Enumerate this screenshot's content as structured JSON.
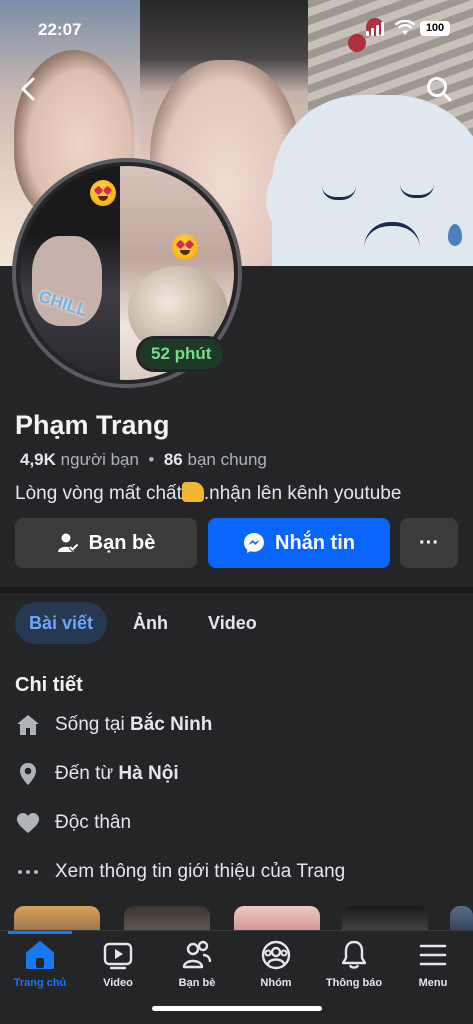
{
  "status_bar": {
    "time": "22:07",
    "battery": "100"
  },
  "profile": {
    "avatar_badge": "52 phút",
    "avatar_sticker": "CHILL",
    "name": "Phạm Trang",
    "friends_count": "4,9K",
    "friends_label": "người bạn",
    "mutual_count": "86",
    "mutual_label": "bạn chung",
    "bio_before": "Lòng vòng mất chất",
    "bio_after": ".nhận lên kênh youtube"
  },
  "actions": {
    "friends": "Bạn bè",
    "message": "Nhắn tin",
    "more": "···"
  },
  "tabs": [
    {
      "label": "Bài viết",
      "active": true
    },
    {
      "label": "Ảnh",
      "active": false
    },
    {
      "label": "Video",
      "active": false
    }
  ],
  "details": {
    "title": "Chi tiết",
    "lives_prefix": "Sống tại ",
    "lives_place": "Bắc Ninh",
    "from_prefix": "Đến từ ",
    "from_place": "Hà Nội",
    "relationship": "Độc thân",
    "see_more": "Xem thông tin giới thiệu của Trang"
  },
  "bottom_nav": [
    {
      "label": "Trang chủ",
      "icon": "home-icon",
      "active": true
    },
    {
      "label": "Video",
      "icon": "video-icon",
      "active": false
    },
    {
      "label": "Bạn bè",
      "icon": "friends-icon",
      "active": false
    },
    {
      "label": "Nhóm",
      "icon": "groups-icon",
      "active": false
    },
    {
      "label": "Thông báo",
      "icon": "bell-icon",
      "active": false
    },
    {
      "label": "Menu",
      "icon": "menu-icon",
      "active": false
    }
  ],
  "colors": {
    "accent": "#0866ff",
    "background": "#242527",
    "badge_text": "#7ad98a"
  }
}
